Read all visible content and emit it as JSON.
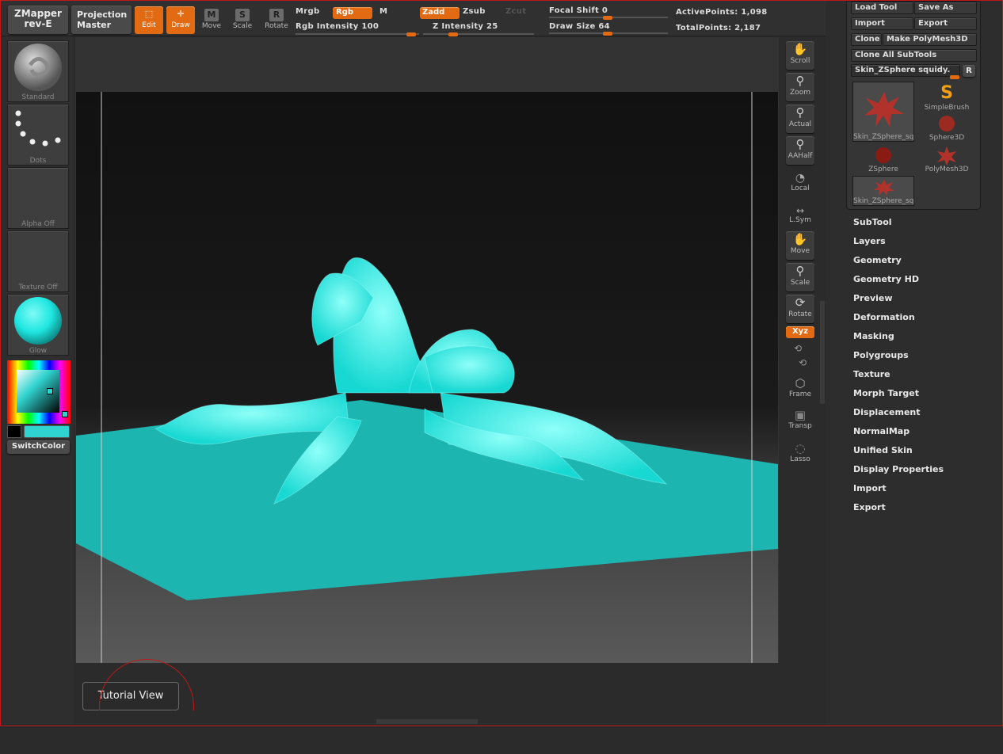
{
  "topbar": {
    "zmapper": {
      "line1": "ZMapper",
      "line2": "rev-E"
    },
    "projection": {
      "line1": "Projection",
      "line2": "Master"
    },
    "edit": "Edit",
    "draw": "Draw",
    "move": "Move",
    "scale": "Scale",
    "rotate": "Rotate",
    "mrgb": "Mrgb",
    "rgb": "Rgb",
    "m": "M",
    "rgb_intensity": "Rgb Intensity 100",
    "zadd": "Zadd",
    "zsub": "Zsub",
    "zcut": "Zcut",
    "z_intensity": "Z Intensity 25",
    "focal_shift": "Focal Shift 0",
    "draw_size": "Draw Size 64",
    "active_points": "ActivePoints: 1,098",
    "total_points": "TotalPoints: 2,187"
  },
  "left_shelf": {
    "brush": "Standard",
    "stroke": "Dots",
    "alpha": "Alpha Off",
    "texture": "Texture Off",
    "material": "Glow",
    "switch_color": "SwitchColor",
    "colors": {
      "main": "#2fd3cf",
      "secondary": "#000000"
    }
  },
  "right_shelf": {
    "scroll": "Scroll",
    "zoom": "Zoom",
    "actual": "Actual",
    "aahalf": "AAHalf",
    "local": "Local",
    "lsym": "L.Sym",
    "move": "Move",
    "scale": "Scale",
    "rotate": "Rotate",
    "xyz": "Xyz",
    "frame": "Frame",
    "transp": "Transp",
    "lasso": "Lasso"
  },
  "tool_panel": {
    "load_tool": "Load Tool",
    "save_as": "Save As",
    "import": "Import",
    "export": "Export",
    "clone": "Clone",
    "make_polymesh": "Make PolyMesh3D",
    "clone_all": "Clone All SubTools",
    "current_tool": "Skin_ZSphere squidy.",
    "r": "R",
    "tools": [
      {
        "name": "Skin_ZSphere_sq",
        "icon": "squid-thumb-icon"
      },
      {
        "name": "SimpleBrush",
        "icon": "simplebrush-icon"
      },
      {
        "name": "Sphere3D",
        "icon": "sphere3d-icon"
      },
      {
        "name": "ZSphere",
        "icon": "zsphere-icon"
      },
      {
        "name": "PolyMesh3D",
        "icon": "polymesh3d-icon"
      },
      {
        "name": "Skin_ZSphere_sq",
        "icon": "squid-thumb-icon"
      }
    ]
  },
  "menu": [
    "SubTool",
    "Layers",
    "Geometry",
    "Geometry HD",
    "Preview",
    "Deformation",
    "Masking",
    "Polygroups",
    "Texture",
    "Morph Target",
    "Displacement",
    "NormalMap",
    "Unified Skin",
    "Display Properties",
    "Import",
    "Export"
  ],
  "tutorial_view": "Tutorial View",
  "accent": "#e26a12"
}
